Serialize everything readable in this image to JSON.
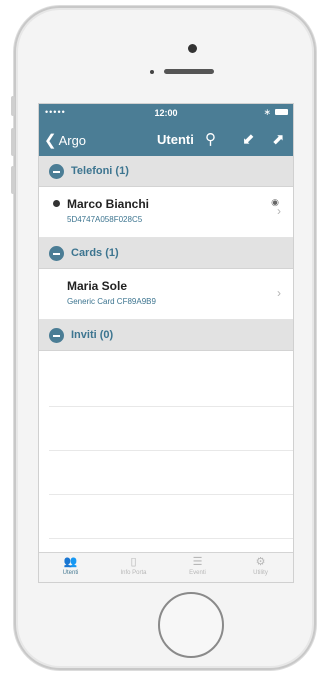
{
  "status": {
    "signal": "•••••",
    "time": "12:00",
    "bluetooth": "∗"
  },
  "nav": {
    "back_label": "Argo",
    "title": "Utenti",
    "icons": [
      "search-icon",
      "add-user-icon",
      "remove-user-icon"
    ]
  },
  "sections": [
    {
      "label": "Telefoni (1)",
      "rows": [
        {
          "name": "Marco Bianchi",
          "sub": "5D4747A058F028C5"
        }
      ]
    },
    {
      "label": "Cards (1)",
      "rows": [
        {
          "name": "Maria Sole",
          "sub": "Generic Card CF89A9B9"
        }
      ]
    },
    {
      "label": "Inviti (0)",
      "rows": []
    }
  ],
  "tabs": [
    {
      "label": "Utenti",
      "icon": "users-icon",
      "active": true
    },
    {
      "label": "Info Porta",
      "icon": "door-icon",
      "active": false
    },
    {
      "label": "Eventi",
      "icon": "list-icon",
      "active": false
    },
    {
      "label": "Utility",
      "icon": "gear-icon",
      "active": false
    }
  ],
  "colors": {
    "accent": "#4b7d95",
    "section_bg": "#e2e2e2"
  }
}
